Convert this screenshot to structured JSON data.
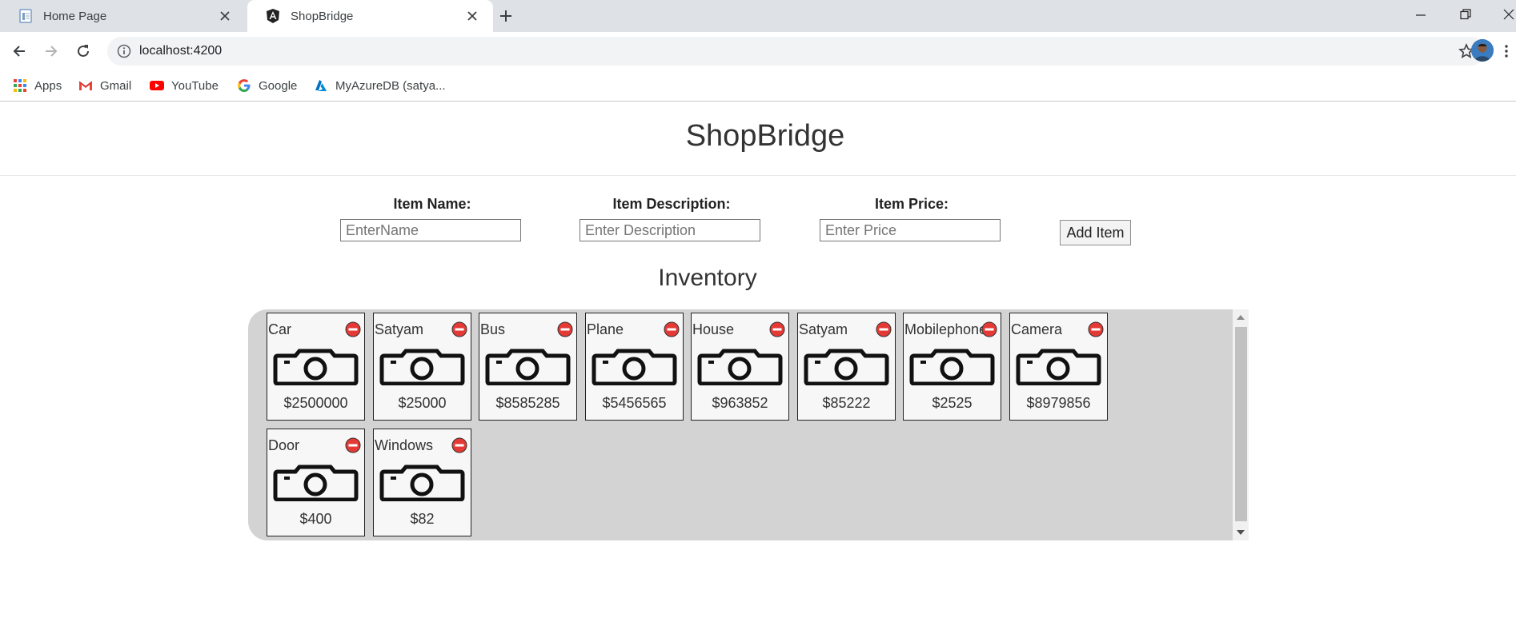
{
  "browser": {
    "tabs": [
      {
        "title": "Home Page",
        "active": false,
        "icon": "document-icon"
      },
      {
        "title": "ShopBridge",
        "active": true,
        "icon": "angular-icon"
      }
    ],
    "address": "localhost:4200",
    "bookmarks": [
      {
        "label": "Apps",
        "icon": "apps-grid-icon"
      },
      {
        "label": "Gmail",
        "icon": "gmail-icon"
      },
      {
        "label": "YouTube",
        "icon": "youtube-icon"
      },
      {
        "label": "Google",
        "icon": "google-icon"
      },
      {
        "label": "MyAzureDB (satya...",
        "icon": "azure-icon"
      }
    ]
  },
  "page": {
    "title": "ShopBridge",
    "form": {
      "name_label": "Item Name:",
      "name_placeholder": "EnterName",
      "description_label": "Item Description:",
      "description_placeholder": "Enter Description",
      "price_label": "Item Price:",
      "price_placeholder": "Enter Price",
      "add_button": "Add Item"
    },
    "inventory_title": "Inventory",
    "items": [
      {
        "name": "Car",
        "price": "$2500000"
      },
      {
        "name": "Satyam",
        "price": "$25000"
      },
      {
        "name": "Bus",
        "price": "$8585285"
      },
      {
        "name": "Plane",
        "price": "$5456565"
      },
      {
        "name": "House",
        "price": "$963852"
      },
      {
        "name": "Satyam",
        "price": "$85222"
      },
      {
        "name": "Mobilephone",
        "price": "$2525"
      },
      {
        "name": "Camera",
        "price": "$8979856"
      },
      {
        "name": "Door",
        "price": "$400"
      },
      {
        "name": "Windows",
        "price": "$82"
      }
    ]
  },
  "colors": {
    "tabstrip": "#dee1e6",
    "panel": "#d3d3d3",
    "delete_icon": "#e53935"
  }
}
